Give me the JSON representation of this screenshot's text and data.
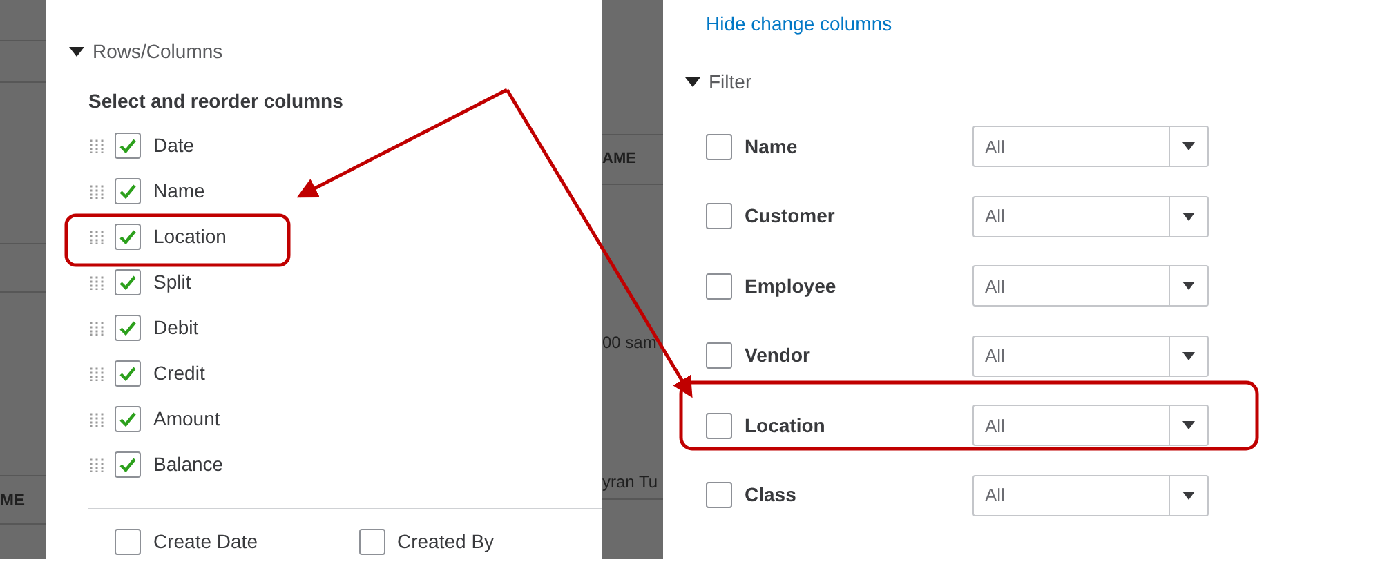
{
  "background_table_left": {
    "header": "ME"
  },
  "columns_panel": {
    "section": {
      "label": "Rows/Columns",
      "expanded": true
    },
    "heading": "Select and reorder columns",
    "columns": [
      {
        "label": "Date",
        "checked": true
      },
      {
        "label": "Name",
        "checked": true
      },
      {
        "label": "Location",
        "checked": true
      },
      {
        "label": "Split",
        "checked": true
      },
      {
        "label": "Debit",
        "checked": true
      },
      {
        "label": "Credit",
        "checked": true
      },
      {
        "label": "Amount",
        "checked": true
      },
      {
        "label": "Balance",
        "checked": true
      }
    ],
    "extra_columns": [
      {
        "label": "Create Date",
        "checked": false
      },
      {
        "label": "Created By",
        "checked": false
      }
    ]
  },
  "background_table_right": {
    "header": "AME",
    "cells": [
      "00 sam",
      "yran Tu"
    ]
  },
  "filter_panel": {
    "link": "Hide change columns",
    "section": {
      "label": "Filter",
      "expanded": true
    },
    "filters": [
      {
        "label": "Name",
        "checked": false,
        "value": "All"
      },
      {
        "label": "Customer",
        "checked": false,
        "value": "All"
      },
      {
        "label": "Employee",
        "checked": false,
        "value": "All"
      },
      {
        "label": "Vendor",
        "checked": false,
        "value": "All"
      },
      {
        "label": "Location",
        "checked": false,
        "value": "All"
      },
      {
        "label": "Class",
        "checked": false,
        "value": "All"
      }
    ]
  }
}
